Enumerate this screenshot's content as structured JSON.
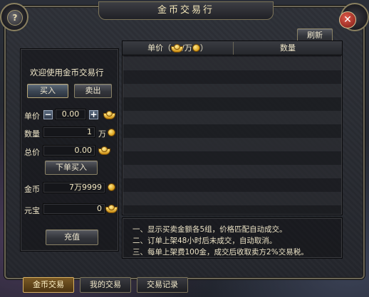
{
  "window": {
    "title": "金币交易行",
    "help_label": "?",
    "close_label": "✕",
    "refresh_label": "刷新"
  },
  "left": {
    "welcome": "欢迎使用金币交易行",
    "buy_label": "买入",
    "sell_label": "卖出",
    "price_label": "单价",
    "price_value": "0.00",
    "minus_label": "−",
    "plus_label": "+",
    "quantity_label": "数量",
    "quantity_value": "1",
    "quantity_unit": "万",
    "total_label": "总价",
    "total_value": "0.00",
    "order_button_label": "下单买入",
    "gold_label": "金币",
    "gold_value": "7万9999",
    "yuanbao_label": "元宝",
    "yuanbao_value": "0",
    "recharge_label": "充值"
  },
  "table": {
    "col_price_prefix": "单价（",
    "col_price_mid": "/万",
    "col_price_suffix": "）",
    "col_quantity": "数量",
    "rows": 12
  },
  "notice": [
    "一、显示买卖金额各5组，价格匹配自动成交。",
    "二、订单上架48小时后未成交，自动取消。",
    "三、每单上架费100金，成交后收取卖方2%交易税。"
  ],
  "tabs": [
    {
      "label": "金币交易",
      "active": true
    },
    {
      "label": "我的交易",
      "active": false
    },
    {
      "label": "交易记录",
      "active": false
    }
  ],
  "icons": {
    "coin": "gold-coin-icon",
    "ingot": "gold-ingot-icon"
  },
  "colors": {
    "accent_gold": "#f4e9c2",
    "frame": "#6b6656",
    "active_tab": "#7a5a26"
  }
}
